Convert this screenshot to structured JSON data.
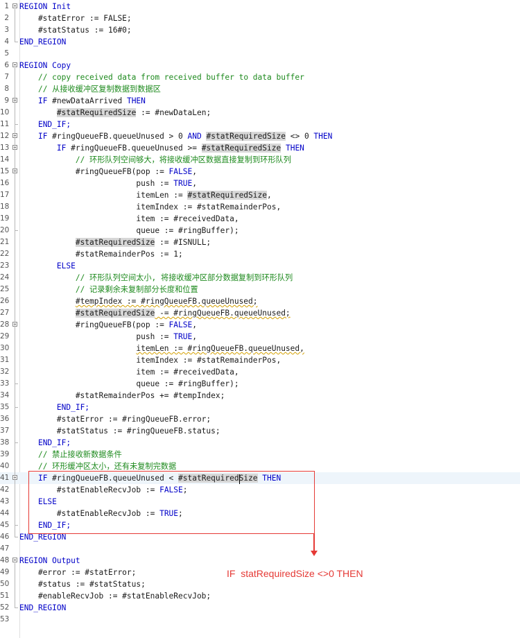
{
  "editor": {
    "lines": [
      {
        "n": "1",
        "segs": [
          {
            "t": "REGION Init",
            "c": "kw"
          }
        ]
      },
      {
        "n": "2",
        "segs": [
          {
            "t": "    #statError := FALSE;"
          }
        ]
      },
      {
        "n": "3",
        "segs": [
          {
            "t": "    #statStatus := 16#0;"
          }
        ]
      },
      {
        "n": "4",
        "segs": [
          {
            "t": "END_REGION",
            "c": "kw"
          }
        ]
      },
      {
        "n": "5",
        "segs": []
      },
      {
        "n": "6",
        "segs": [
          {
            "t": "REGION Copy",
            "c": "kw"
          }
        ]
      },
      {
        "n": "7",
        "segs": [
          {
            "t": "    "
          },
          {
            "t": "// copy received data from received buffer to data buffer",
            "c": "cm"
          }
        ]
      },
      {
        "n": "8",
        "segs": [
          {
            "t": "    "
          },
          {
            "t": "// 从接收缓冲区复制数据到数据区",
            "c": "cm"
          }
        ]
      },
      {
        "n": "9",
        "segs": [
          {
            "t": "    "
          },
          {
            "t": "IF",
            "c": "kw"
          },
          {
            "t": " #newDataArrived "
          },
          {
            "t": "THEN",
            "c": "kw"
          }
        ]
      },
      {
        "n": "10",
        "segs": [
          {
            "t": "        "
          },
          {
            "t": "#statRequiredSize",
            "c": "hl"
          },
          {
            "t": " := #newDataLen;"
          }
        ]
      },
      {
        "n": "11",
        "segs": [
          {
            "t": "    "
          },
          {
            "t": "END_IF;",
            "c": "kw"
          }
        ]
      },
      {
        "n": "12",
        "segs": [
          {
            "t": "    "
          },
          {
            "t": "IF",
            "c": "kw"
          },
          {
            "t": " #ringQueueFB.queueUnused > 0 "
          },
          {
            "t": "AND",
            "c": "kw"
          },
          {
            "t": " "
          },
          {
            "t": "#statRequiredSize",
            "c": "hl"
          },
          {
            "t": " <> 0 "
          },
          {
            "t": "THEN",
            "c": "kw"
          }
        ]
      },
      {
        "n": "13",
        "segs": [
          {
            "t": "        "
          },
          {
            "t": "IF",
            "c": "kw"
          },
          {
            "t": " #ringQueueFB.queueUnused >= "
          },
          {
            "t": "#statRequiredSize",
            "c": "hl"
          },
          {
            "t": " "
          },
          {
            "t": "THEN",
            "c": "kw"
          }
        ]
      },
      {
        "n": "14",
        "segs": [
          {
            "t": "            "
          },
          {
            "t": "// 环形队列空间够大，将接收缓冲区数据直接复制到环形队列",
            "c": "cm"
          }
        ]
      },
      {
        "n": "15",
        "segs": [
          {
            "t": "            #ringQueueFB(pop := "
          },
          {
            "t": "FALSE",
            "c": "kw"
          },
          {
            "t": ","
          }
        ]
      },
      {
        "n": "16",
        "segs": [
          {
            "t": "                         push := "
          },
          {
            "t": "TRUE",
            "c": "kw"
          },
          {
            "t": ","
          }
        ]
      },
      {
        "n": "17",
        "segs": [
          {
            "t": "                         itemLen := "
          },
          {
            "t": "#statRequiredSize",
            "c": "hl"
          },
          {
            "t": ","
          }
        ]
      },
      {
        "n": "18",
        "segs": [
          {
            "t": "                         itemIndex := #statRemainderPos,"
          }
        ]
      },
      {
        "n": "19",
        "segs": [
          {
            "t": "                         item := #receivedData,"
          }
        ]
      },
      {
        "n": "20",
        "segs": [
          {
            "t": "                         queue := #ringBuffer);"
          }
        ]
      },
      {
        "n": "21",
        "segs": [
          {
            "t": "            "
          },
          {
            "t": "#statRequiredSize",
            "c": "hl"
          },
          {
            "t": " := #ISNULL;"
          }
        ]
      },
      {
        "n": "22",
        "segs": [
          {
            "t": "            #statRemainderPos := 1;"
          }
        ]
      },
      {
        "n": "23",
        "segs": [
          {
            "t": "        "
          },
          {
            "t": "ELSE",
            "c": "kw"
          }
        ]
      },
      {
        "n": "24",
        "segs": [
          {
            "t": "            "
          },
          {
            "t": "// 环形队列空间太小, 将接收缓冲区部分数据复制到环形队列",
            "c": "cm"
          }
        ]
      },
      {
        "n": "25",
        "segs": [
          {
            "t": "            "
          },
          {
            "t": "// 记录剩余未复制部分长度和位置",
            "c": "cm"
          }
        ]
      },
      {
        "n": "26",
        "segs": [
          {
            "t": "            "
          },
          {
            "t": "#tempIndex := #ringQueueFB.queueUnused;",
            "c": "sq"
          }
        ]
      },
      {
        "n": "27",
        "segs": [
          {
            "t": "            "
          },
          {
            "t": "#statRequiredSize",
            "c": "hl"
          },
          {
            "t": " -= #ringQueueFB.queueUnused;",
            "c": "sq"
          }
        ]
      },
      {
        "n": "28",
        "segs": [
          {
            "t": "            #ringQueueFB(pop := "
          },
          {
            "t": "FALSE",
            "c": "kw"
          },
          {
            "t": ","
          }
        ]
      },
      {
        "n": "29",
        "segs": [
          {
            "t": "                         push := "
          },
          {
            "t": "TRUE",
            "c": "kw"
          },
          {
            "t": ","
          }
        ]
      },
      {
        "n": "30",
        "segs": [
          {
            "t": "                         "
          },
          {
            "t": "itemLen := #ringQueueFB.queueUnused,",
            "c": "sq"
          }
        ]
      },
      {
        "n": "31",
        "segs": [
          {
            "t": "                         itemIndex := #statRemainderPos,"
          }
        ]
      },
      {
        "n": "32",
        "segs": [
          {
            "t": "                         item := #receivedData,"
          }
        ]
      },
      {
        "n": "33",
        "segs": [
          {
            "t": "                         queue := #ringBuffer);"
          }
        ]
      },
      {
        "n": "34",
        "segs": [
          {
            "t": "            #statRemainderPos += #tempIndex;"
          }
        ]
      },
      {
        "n": "35",
        "segs": [
          {
            "t": "        "
          },
          {
            "t": "END_IF;",
            "c": "kw"
          }
        ]
      },
      {
        "n": "36",
        "segs": [
          {
            "t": "        #statError := #ringQueueFB.error;"
          }
        ]
      },
      {
        "n": "37",
        "segs": [
          {
            "t": "        #statStatus := #ringQueueFB.status;"
          }
        ]
      },
      {
        "n": "38",
        "segs": [
          {
            "t": "    "
          },
          {
            "t": "END_IF;",
            "c": "kw"
          }
        ]
      },
      {
        "n": "39",
        "segs": [
          {
            "t": "    "
          },
          {
            "t": "// 禁止接收新数据条件",
            "c": "cm"
          }
        ]
      },
      {
        "n": "40",
        "segs": [
          {
            "t": "    "
          },
          {
            "t": "// 环形缓冲区太小，还有未复制完数据",
            "c": "cm"
          }
        ]
      },
      {
        "n": "41",
        "segs": [
          {
            "t": "    "
          },
          {
            "t": "IF",
            "c": "kw"
          },
          {
            "t": " #ringQueueFB.queueUnused < "
          },
          {
            "t": "#statRequiredSize",
            "c": "hl"
          },
          {
            "t": " "
          },
          {
            "t": "THEN",
            "c": "kw"
          }
        ]
      },
      {
        "n": "42",
        "segs": [
          {
            "t": "        #statEnableRecvJob := "
          },
          {
            "t": "FALSE",
            "c": "kw"
          },
          {
            "t": ";"
          }
        ]
      },
      {
        "n": "43",
        "segs": [
          {
            "t": "    "
          },
          {
            "t": "ELSE",
            "c": "kw"
          }
        ]
      },
      {
        "n": "44",
        "segs": [
          {
            "t": "        #statEnableRecvJob := "
          },
          {
            "t": "TRUE",
            "c": "kw"
          },
          {
            "t": ";"
          }
        ]
      },
      {
        "n": "45",
        "segs": [
          {
            "t": "    "
          },
          {
            "t": "END_IF;",
            "c": "kw"
          }
        ]
      },
      {
        "n": "46",
        "segs": [
          {
            "t": "END_REGION",
            "c": "kw"
          }
        ]
      },
      {
        "n": "47",
        "segs": []
      },
      {
        "n": "48",
        "segs": [
          {
            "t": "REGION Output",
            "c": "kw"
          }
        ]
      },
      {
        "n": "49",
        "segs": [
          {
            "t": "    #error := #statError;"
          }
        ]
      },
      {
        "n": "50",
        "segs": [
          {
            "t": "    #status := #statStatus;"
          }
        ]
      },
      {
        "n": "51",
        "segs": [
          {
            "t": "    #enableRecvJob := #statEnableRecvJob;"
          }
        ]
      },
      {
        "n": "52",
        "segs": [
          {
            "t": "END_REGION",
            "c": "kw"
          }
        ]
      },
      {
        "n": "53",
        "segs": []
      }
    ]
  },
  "annotation": {
    "text": "IF  statRequiredSize <>0 THEN",
    "color": "#e53935"
  },
  "colors": {
    "keyword": "#0000c8",
    "comment": "#1e8a1e",
    "highlight": "#d7d7d7",
    "active_line": "#eef5fb"
  }
}
